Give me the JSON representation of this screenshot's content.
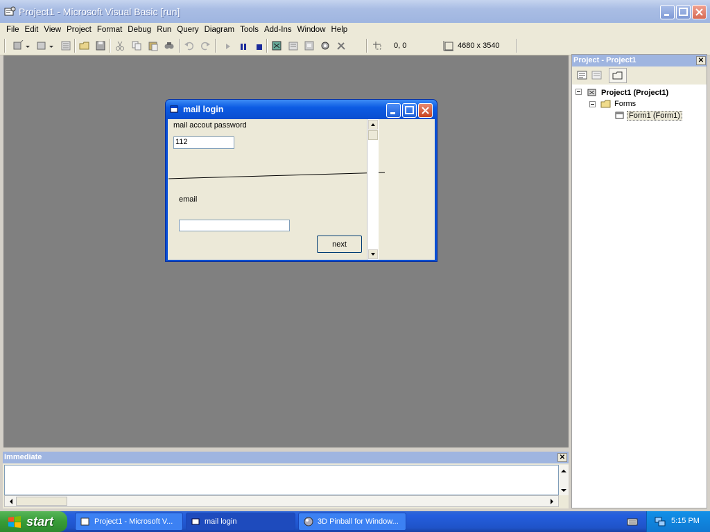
{
  "window": {
    "title": "Project1 - Microsoft Visual Basic [run]"
  },
  "menu": [
    "File",
    "Edit",
    "View",
    "Project",
    "Format",
    "Debug",
    "Run",
    "Query",
    "Diagram",
    "Tools",
    "Add-Ins",
    "Window",
    "Help"
  ],
  "toolbar": {
    "position": "0, 0",
    "size": "4680 x 3540"
  },
  "form": {
    "title": "mail login",
    "password_label": "mail accout password",
    "password_value": "112",
    "email_label": "email",
    "email_value": "",
    "next_label": "next"
  },
  "project_explorer": {
    "title": "Project - Project1",
    "root": "Project1 (Project1)",
    "folder": "Forms",
    "item": "Form1 (Form1)"
  },
  "immediate": {
    "title": "Immediate"
  },
  "taskbar": {
    "start_label": "start",
    "tasks": [
      "Project1 - Microsoft V...",
      "mail login",
      "3D Pinball for Window..."
    ],
    "clock": "5:15 PM"
  },
  "colors": {
    "xp_blue": "#0a4fd4",
    "inactive_title": "#9fb5e0",
    "start_green": "#379c37"
  }
}
